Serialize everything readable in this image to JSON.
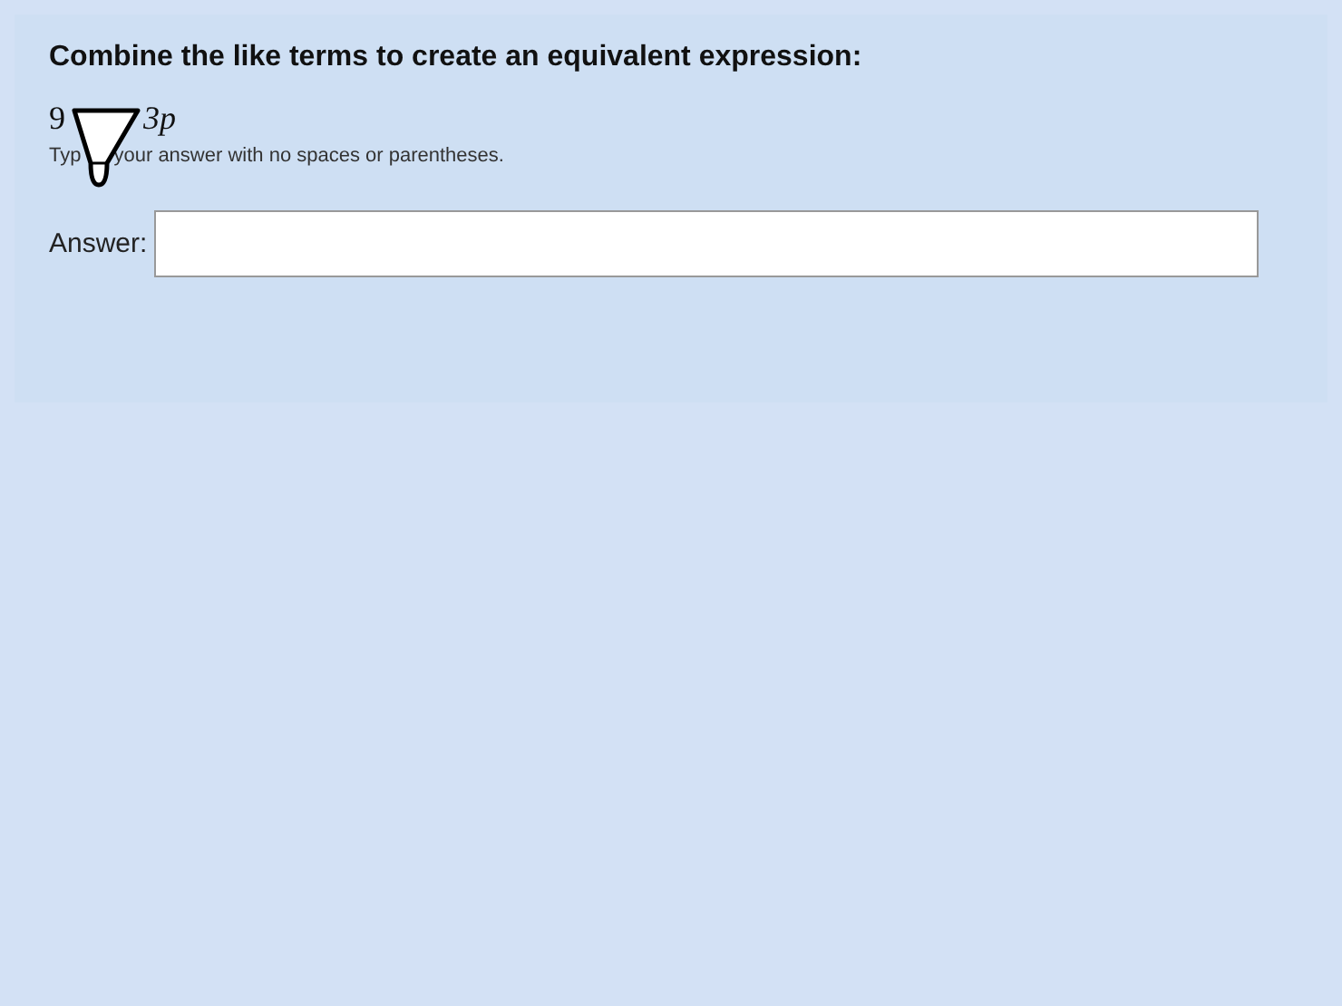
{
  "question": {
    "title": "Combine the like terms to create an equivalent expression:",
    "expression_parts": [
      "9",
      "3p"
    ],
    "instruction_parts": [
      "Typ",
      "your answer with no spaces or parentheses."
    ],
    "answer": {
      "label": "Answer:"
    }
  }
}
